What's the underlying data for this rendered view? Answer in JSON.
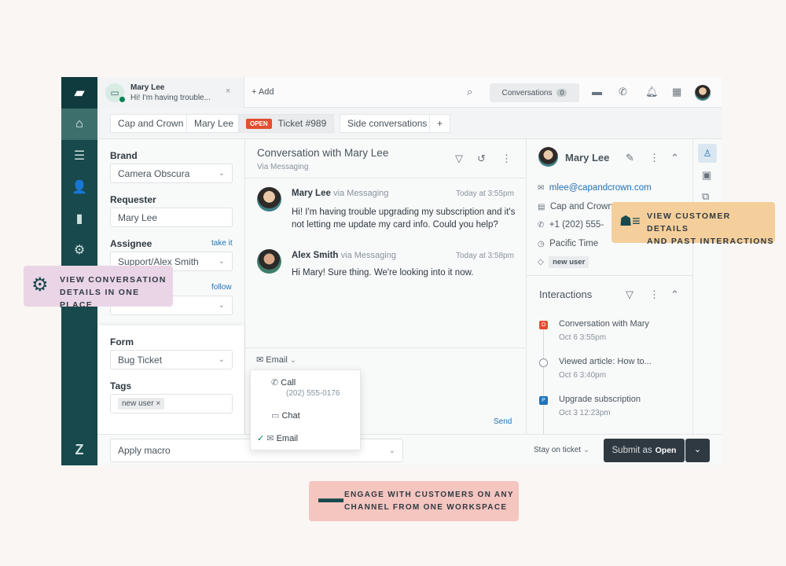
{
  "top": {
    "tab_name": "Mary Lee",
    "tab_preview": "Hi! I'm having trouble...",
    "add": "+ Add",
    "conversations_label": "Conversations",
    "conversations_count": "0"
  },
  "crumbs": [
    "Cap and Crown",
    "Mary Lee",
    "Ticket #989",
    "Side conversations",
    "+"
  ],
  "status_badge": "OPEN",
  "props": {
    "brand_label": "Brand",
    "brand_value": "Camera Obscura",
    "requester_label": "Requester",
    "requester_value": "Mary Lee",
    "assignee_label": "Assignee",
    "take_it": "take it",
    "assignee_value": "Support/Alex Smith",
    "follow": "follow",
    "form_label": "Form",
    "form_value": "Bug Ticket",
    "tags_label": "Tags",
    "tag": "new user"
  },
  "conversation": {
    "title": "Conversation with Mary Lee",
    "subtitle": "Via Messaging",
    "messages": [
      {
        "author": "Mary Lee",
        "via": "via Messaging",
        "time": "Today at 3:55pm",
        "text": "Hi! I'm having trouble upgrading my subscription and it's not letting me update my card info. Could you help?"
      },
      {
        "author": "Alex Smith",
        "via": "via Messaging",
        "time": "Today at 3:58pm",
        "text": "Hi Mary! Sure thing. We're looking into it now."
      }
    ],
    "channel": "Email",
    "send": "Send",
    "channel_menu": [
      {
        "label": "Call",
        "sub": "(202) 555-0176"
      },
      {
        "label": "Chat"
      },
      {
        "label": "Email",
        "checked": true
      }
    ]
  },
  "customer": {
    "name": "Mary Lee",
    "email": "mlee@capandcrown.com",
    "org": "Cap and Crown",
    "phone": "+1 (202) 555-",
    "timezone": "Pacific Time",
    "tag": "new user"
  },
  "interactions": {
    "title": "Interactions",
    "items": [
      {
        "title": "Conversation with Mary",
        "time": "Oct 6 3:55pm",
        "marker": "O",
        "color": "#e34f32"
      },
      {
        "title": "Viewed article: How to...",
        "time": "Oct 6 3:40pm",
        "marker": "",
        "color": "#ffffff"
      },
      {
        "title": "Upgrade subscription",
        "time": "Oct 3 12:23pm",
        "marker": "P",
        "color": "#1f73b7"
      }
    ]
  },
  "footer": {
    "macro": "Apply macro",
    "stay": "Stay on ticket",
    "submit": "Submit as",
    "submit_status": "Open"
  },
  "callouts": {
    "left_1": "VIEW CONVERSATION",
    "left_2": "DETAILS IN ONE PLACE",
    "right_1": "VIEW CUSTOMER DETAILS",
    "right_2": "AND PAST INTERACTIONS",
    "bottom_1": "ENGAGE WITH CUSTOMERS ON ANY",
    "bottom_2": "CHANNEL FROM ONE WORKSPACE"
  },
  "colors": {
    "nav": "#17494d",
    "open": "#e34f32",
    "callout_pink": "#ead5e6",
    "callout_orange": "#f5cf9b",
    "callout_red": "#f5c5c0",
    "submit": "#2f3941"
  }
}
